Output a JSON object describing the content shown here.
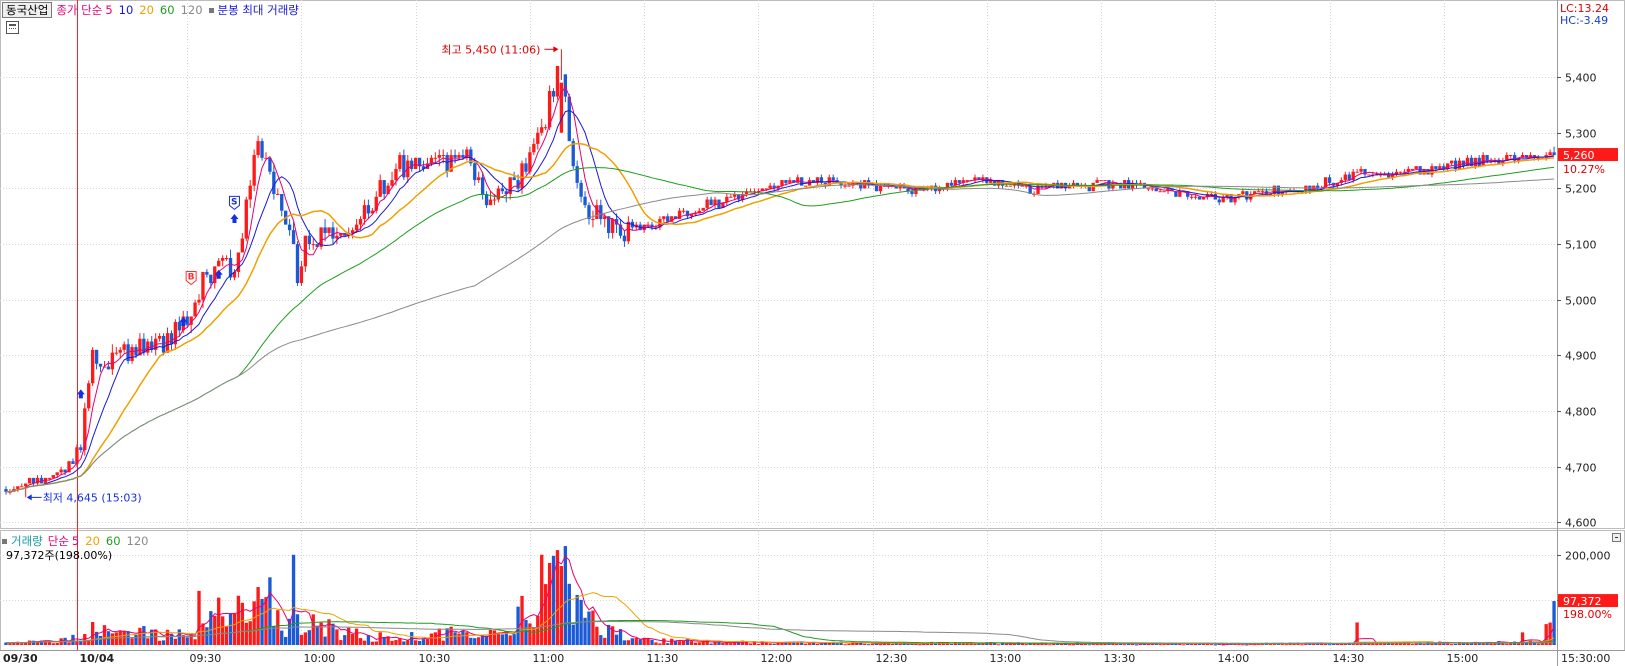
{
  "ticker": "동국산업",
  "price_legend": {
    "label": "종가 단순",
    "periods": [
      "5",
      "10",
      "20",
      "60",
      "120"
    ],
    "colors": [
      "#e60073",
      "#1a1ad6",
      "#f0a000",
      "#1f9e1f",
      "#8a8a8a"
    ],
    "extra": "분봉 최대 거래량"
  },
  "volume_legend": {
    "label": "거래량",
    "sub": "단순",
    "periods": [
      "5",
      "20",
      "60",
      "120"
    ],
    "colors": [
      "#e60073",
      "#f0a000",
      "#1f9e1f",
      "#8a8a8a"
    ],
    "current": "97,372주(198.00%)"
  },
  "lc": "LC:13.24",
  "hc": "HC:-3.49",
  "high_label": "최고 5,450 (11:06)",
  "low_label": "최저 4,645 (15:03)",
  "last_price_label": "5,260",
  "last_pct_label": "10.27%",
  "last_volume_label": "97,372",
  "last_vol_pct_label": "198.00%",
  "signals": {
    "buy": "B",
    "sell": "S"
  },
  "chart_data": {
    "type": "candlestick",
    "ylim": [
      4590,
      5490
    ],
    "y_ticks": [
      4600,
      4700,
      4800,
      4900,
      5000,
      5100,
      5200,
      5300,
      5400
    ],
    "y_tick_labels": [
      "4,600",
      "4,700",
      "4,800",
      "4,900",
      "5,000",
      "5,100",
      "5,200",
      "5,300",
      "5,400"
    ],
    "x_tick_labels": [
      "09/30",
      "10/04",
      "09:30",
      "10:00",
      "10:30",
      "11:00",
      "11:30",
      "12:00",
      "12:30",
      "13:00",
      "13:30",
      "14:00",
      "14:30",
      "15:00",
      "15:30:00"
    ],
    "volume_ylim": [
      0,
      215000
    ],
    "volume_ticks": [
      100000,
      200000
    ],
    "volume_tick_labels": [
      "",
      "200,000"
    ],
    "high": 5450,
    "low": 4645,
    "last_close": 5260,
    "last_volume": 97372,
    "price_anchors": [
      [
        0,
        4660
      ],
      [
        12,
        4680
      ],
      [
        16,
        4700
      ],
      [
        19,
        4740
      ],
      [
        22,
        4890
      ],
      [
        30,
        4905
      ],
      [
        40,
        4920
      ],
      [
        46,
        4960
      ],
      [
        50,
        5040
      ],
      [
        58,
        5060
      ],
      [
        60,
        5120
      ],
      [
        63,
        5280
      ],
      [
        68,
        5200
      ],
      [
        72,
        5130
      ],
      [
        74,
        5040
      ],
      [
        76,
        5100
      ],
      [
        85,
        5120
      ],
      [
        92,
        5170
      ],
      [
        100,
        5240
      ],
      [
        110,
        5240
      ],
      [
        117,
        5260
      ],
      [
        122,
        5170
      ],
      [
        130,
        5210
      ],
      [
        137,
        5330
      ],
      [
        141,
        5420
      ],
      [
        144,
        5240
      ],
      [
        148,
        5160
      ],
      [
        155,
        5120
      ],
      [
        165,
        5140
      ],
      [
        178,
        5170
      ],
      [
        188,
        5190
      ],
      [
        200,
        5215
      ],
      [
        215,
        5210
      ],
      [
        230,
        5200
      ],
      [
        245,
        5215
      ],
      [
        260,
        5200
      ],
      [
        275,
        5205
      ],
      [
        285,
        5210
      ],
      [
        300,
        5185
      ],
      [
        310,
        5180
      ],
      [
        320,
        5195
      ],
      [
        330,
        5200
      ],
      [
        345,
        5230
      ],
      [
        360,
        5230
      ],
      [
        375,
        5250
      ],
      [
        385,
        5255
      ],
      [
        393,
        5260
      ]
    ],
    "volume_anchors": [
      [
        0,
        6000
      ],
      [
        12,
        7000
      ],
      [
        20,
        18000
      ],
      [
        22,
        40000
      ],
      [
        40,
        20000
      ],
      [
        48,
        30000
      ],
      [
        55,
        60000
      ],
      [
        56,
        100000
      ],
      [
        59,
        70000
      ],
      [
        62,
        140000
      ],
      [
        66,
        80000
      ],
      [
        70,
        40000
      ],
      [
        76,
        55000
      ],
      [
        85,
        25000
      ],
      [
        100,
        15000
      ],
      [
        115,
        30000
      ],
      [
        120,
        12000
      ],
      [
        136,
        100000
      ],
      [
        141,
        150000
      ],
      [
        148,
        60000
      ],
      [
        160,
        10000
      ],
      [
        200,
        5000
      ],
      [
        300,
        3000
      ],
      [
        350,
        4000
      ],
      [
        390,
        6000
      ],
      [
        393,
        97372
      ]
    ],
    "volume_spikes": [
      [
        73,
        200000
      ],
      [
        49,
        120000
      ],
      [
        54,
        105000
      ],
      [
        67,
        150000
      ],
      [
        136,
        200000
      ],
      [
        141,
        175000
      ],
      [
        137,
        135000
      ],
      [
        146,
        100000
      ],
      [
        343,
        50000
      ],
      [
        385,
        28000
      ]
    ],
    "buy_signals": [
      [
        19,
        4830
      ],
      [
        45,
        4960
      ],
      [
        54,
        5045
      ],
      [
        58,
        5145
      ]
    ],
    "sell_signals": [
      [
        47,
        5040
      ],
      [
        58,
        5175
      ]
    ]
  }
}
